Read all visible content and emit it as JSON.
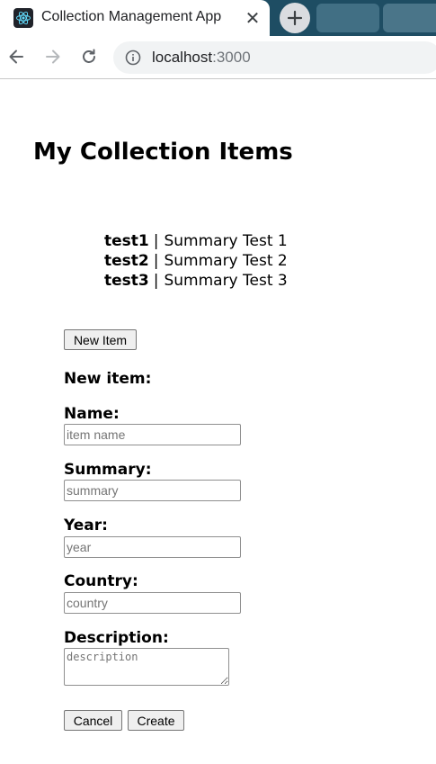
{
  "browser": {
    "tab_title": "Collection Management App",
    "tab_close_glyph": "✕",
    "url_host": "localhost",
    "url_port": ":3000",
    "icons": [
      "react-favicon-icon",
      "close-icon",
      "plus-icon",
      "back-arrow-icon",
      "forward-arrow-icon",
      "reload-icon",
      "info-icon"
    ]
  },
  "page": {
    "title": "My Collection Items",
    "separator": "|",
    "items": [
      {
        "name": "test1",
        "summary": "Summary Test 1"
      },
      {
        "name": "test2",
        "summary": "Summary Test 2"
      },
      {
        "name": "test3",
        "summary": "Summary Test 3"
      }
    ],
    "new_item_button": "New Item"
  },
  "form": {
    "heading": "New item:",
    "name": {
      "label": "Name:",
      "placeholder": "item name",
      "value": ""
    },
    "summary": {
      "label": "Summary:",
      "placeholder": "summary",
      "value": ""
    },
    "year": {
      "label": "Year:",
      "placeholder": "year",
      "value": ""
    },
    "country": {
      "label": "Country:",
      "placeholder": "country",
      "value": ""
    },
    "description": {
      "label": "Description:",
      "placeholder": "description",
      "value": ""
    },
    "cancel_button": "Cancel",
    "create_button": "Create"
  },
  "colors": {
    "tab_strip": "#1e4d63",
    "react_logo": "#61dafb",
    "omnibox": "#f1f3f4"
  }
}
